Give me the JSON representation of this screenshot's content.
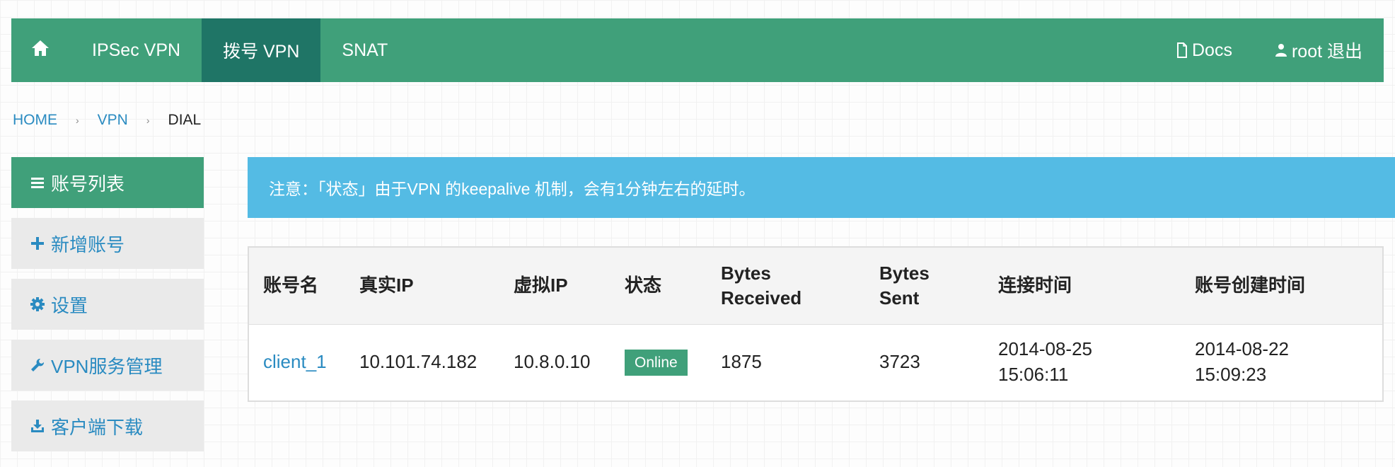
{
  "navbar": {
    "home_icon": "home-icon",
    "items": [
      {
        "label": "IPSec VPN",
        "active": false
      },
      {
        "label": "拨号 VPN",
        "active": true
      },
      {
        "label": "SNAT",
        "active": false
      }
    ],
    "docs": {
      "label": "Docs",
      "icon": "document-icon"
    },
    "user": {
      "label": "root 退出",
      "icon": "user-icon"
    },
    "colors": {
      "bar": "#40a07a",
      "active": "#1f7566"
    }
  },
  "breadcrumb": {
    "items": [
      "HOME",
      "VPN",
      "DIAL"
    ],
    "separator": "›"
  },
  "sidebar": {
    "items": [
      {
        "label": "账号列表",
        "icon": "list-icon",
        "active": true
      },
      {
        "label": "新增账号",
        "icon": "plus-icon",
        "active": false
      },
      {
        "label": "设置",
        "icon": "gear-icon",
        "active": false
      },
      {
        "label": "VPN服务管理",
        "icon": "wrench-icon",
        "active": false
      },
      {
        "label": "客户端下载",
        "icon": "download-icon",
        "active": false
      }
    ]
  },
  "alert": {
    "text": "注意：「状态」由于VPN 的keepalive 机制，会有1分钟左右的延时。",
    "color": "#54bbe4"
  },
  "table": {
    "headers": {
      "name": "账号名",
      "real_ip": "真实IP",
      "virtual_ip": "虚拟IP",
      "status": "状态",
      "bytes_received_1": "Bytes",
      "bytes_received_2": "Received",
      "bytes_sent_1": "Bytes",
      "bytes_sent_2": "Sent",
      "connect_time": "连接时间",
      "created_time": "账号创建时间"
    },
    "rows": [
      {
        "name": "client_1",
        "real_ip": "10.101.74.182",
        "virtual_ip": "10.8.0.10",
        "status": "Online",
        "bytes_received": "1875",
        "bytes_sent": "3723",
        "connect_date": "2014-08-25",
        "connect_clock": "15:06:11",
        "created_date": "2014-08-22",
        "created_clock": "15:09:23"
      }
    ]
  }
}
